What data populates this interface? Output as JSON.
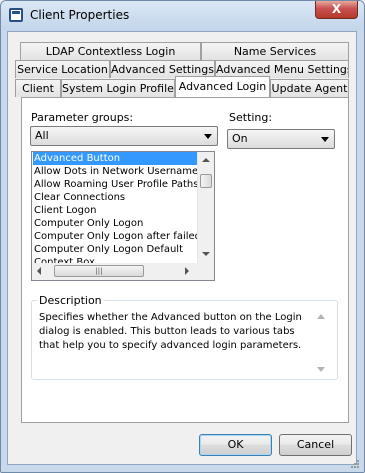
{
  "window": {
    "title": "Client Properties",
    "close_label": "X"
  },
  "tabs": {
    "row1": [
      "LDAP Contextless Login",
      "Name Services"
    ],
    "row2": [
      "Service Location",
      "Advanced Settings",
      "Advanced Menu Settings"
    ],
    "row3": [
      "Client",
      "System Login Profiles",
      "Advanced Login",
      "Update Agent"
    ],
    "active": "Advanced Login"
  },
  "params": {
    "groups_label": "Parameter groups:",
    "groups_value": "All",
    "setting_label": "Setting:",
    "setting_value": "On",
    "list": [
      "Advanced Button",
      "Allow Dots in Network Username",
      "Allow Roaming User Profile Paths t",
      "Clear Connections",
      "Client Logon",
      "Computer Only Logon",
      "Computer Only Logon after failed",
      "Computer Only Logon Default",
      "Context Box"
    ],
    "selected_index": 0
  },
  "description": {
    "label": "Description",
    "text": "Specifies whether the Advanced button on the Login dialog is enabled.  This button leads to various tabs that help you to specify advanced login parameters."
  },
  "buttons": {
    "ok": "OK",
    "cancel": "Cancel"
  }
}
